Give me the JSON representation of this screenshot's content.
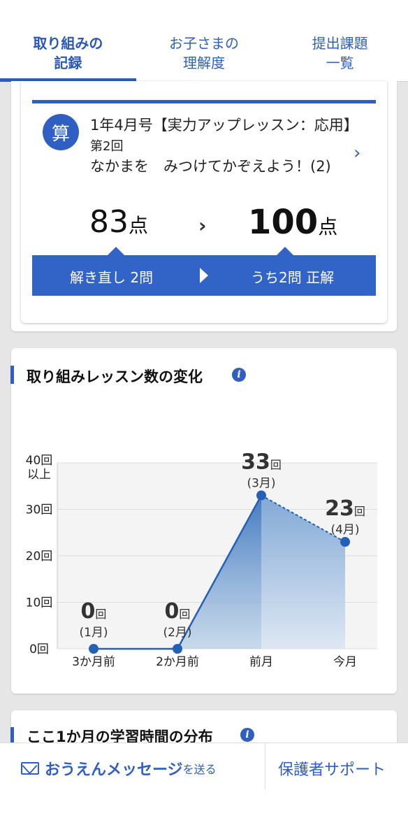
{
  "tabs": [
    {
      "line1": "取り組みの",
      "line2": "記録"
    },
    {
      "line1": "お子さまの",
      "line2": "理解度"
    },
    {
      "line1": "提出課題",
      "line2": "一覧"
    }
  ],
  "lesson": {
    "subject": "算",
    "title_main": "1年4月号【実力アップレッスン：応用】",
    "title_small": "第2回",
    "title_sub": "なかまを　みつけてかぞえよう！(2)",
    "score_before": "83",
    "score_after": "100",
    "score_unit": "点",
    "retry_label": "解き直し 2問",
    "correct_label": "うち2問 正解"
  },
  "lessons_section": {
    "title": "取り組みレッスン数の変化"
  },
  "chart_data": {
    "type": "area",
    "categories": [
      "3か月前",
      "2か月前",
      "前月",
      "今月"
    ],
    "values": [
      0,
      0,
      33,
      23
    ],
    "month_labels": [
      "(1月)",
      "(2月)",
      "(3月)",
      "(4月)"
    ],
    "value_unit": "回",
    "y_ticks": [
      "0回",
      "10回",
      "20回",
      "30回",
      "40回以上"
    ],
    "ylim": [
      0,
      40
    ],
    "grid": true,
    "colors": {
      "line": "#2460b8",
      "fill": "#5a8cc8",
      "grid": "#dddddd"
    }
  },
  "time_section": {
    "title": "ここ1か月の学習時間の分布"
  },
  "footer": {
    "message_main": "おうえんメッセージ",
    "message_small": "を送る",
    "support": "保護者サポート"
  }
}
